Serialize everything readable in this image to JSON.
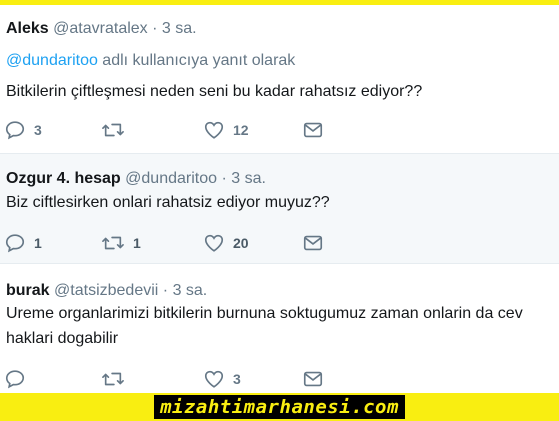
{
  "tweets": [
    {
      "name": "Aleks",
      "handle": "@atavratalex",
      "separator": "·",
      "time": "3 sa.",
      "reply_mention": "@dundaritoo",
      "reply_suffix": " adlı kullanıcıya yanıt olarak",
      "text": "Bitkilerin çiftleşmesi neden seni bu kadar rahatsız ediyor??",
      "replies": "3",
      "retweets": "",
      "likes": "12"
    },
    {
      "name": "Ozgur 4. hesap",
      "handle": "@dundaritoo",
      "separator": "·",
      "time": "3 sa.",
      "text": "Biz ciftlesirken onlari rahatsiz ediyor muyuz??",
      "replies": "1",
      "retweets": "1",
      "likes": "20"
    },
    {
      "name": "burak",
      "handle": "@tatsizbedevii",
      "separator": "·",
      "time": "3 sa.",
      "text_line1": "Ureme organlarimizi bitkilerin burnuna soktugumuz zaman onlarin da cev",
      "text_line2": "haklari dogabilir",
      "replies": "",
      "retweets": "",
      "likes": "3"
    }
  ],
  "icons": {
    "reply": "reply-icon",
    "retweet": "retweet-icon",
    "like": "heart-icon",
    "dm": "envelope-icon"
  },
  "watermark": "mizahtimarhanesi.com",
  "colors": {
    "accent": "#1da1f2",
    "muted": "#657786",
    "banner": "#f9ee11"
  }
}
